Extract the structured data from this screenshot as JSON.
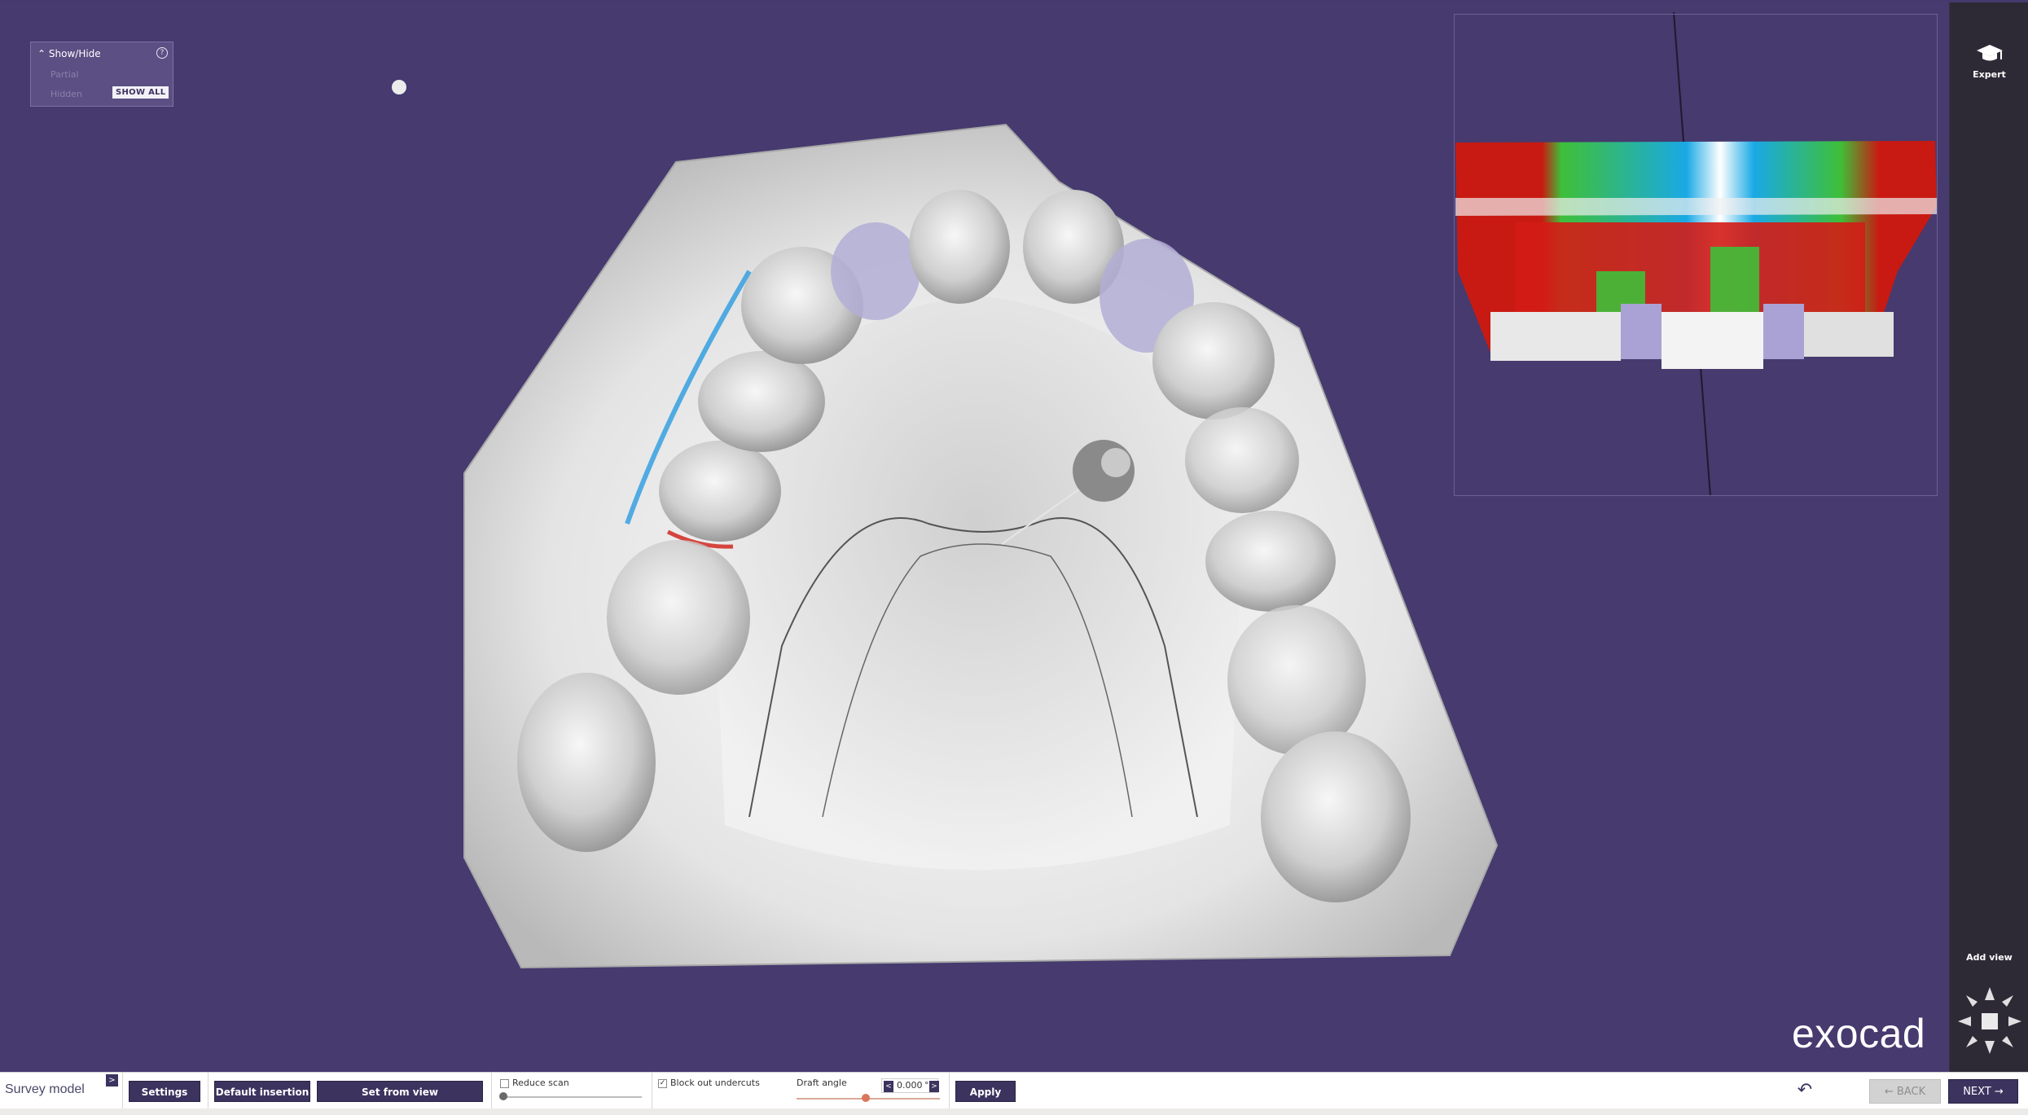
{
  "app": {
    "brand": "exocad"
  },
  "show_hide_panel": {
    "title": "Show/Hide",
    "partial_label": "Partial",
    "hidden_label": "Hidden",
    "show_all_label": "SHOW ALL",
    "help_glyph": "?"
  },
  "sidebar": {
    "expert_label": "Expert",
    "add_view_label": "Add view"
  },
  "toolbar": {
    "mode_title": "Survey model",
    "collapse_glyph": ">",
    "settings_label": "Settings",
    "default_insertion_label": "Default insertion",
    "set_from_view_label": "Set from view",
    "reduce_scan_label": "Reduce scan",
    "reduce_scan_checked": false,
    "block_out_label": "Block out undercuts",
    "block_out_checked": true,
    "draft_angle_label": "Draft angle",
    "draft_angle_value": "0.000",
    "draft_angle_unit": "°",
    "apply_label": "Apply",
    "back_label": "BACK",
    "next_label": "NEXT"
  },
  "colors": {
    "viewport_bg": "#463a6f",
    "accent": "#3c335f",
    "sidebar_bg": "#2e2a35",
    "draft_slider": "#d9775a"
  }
}
